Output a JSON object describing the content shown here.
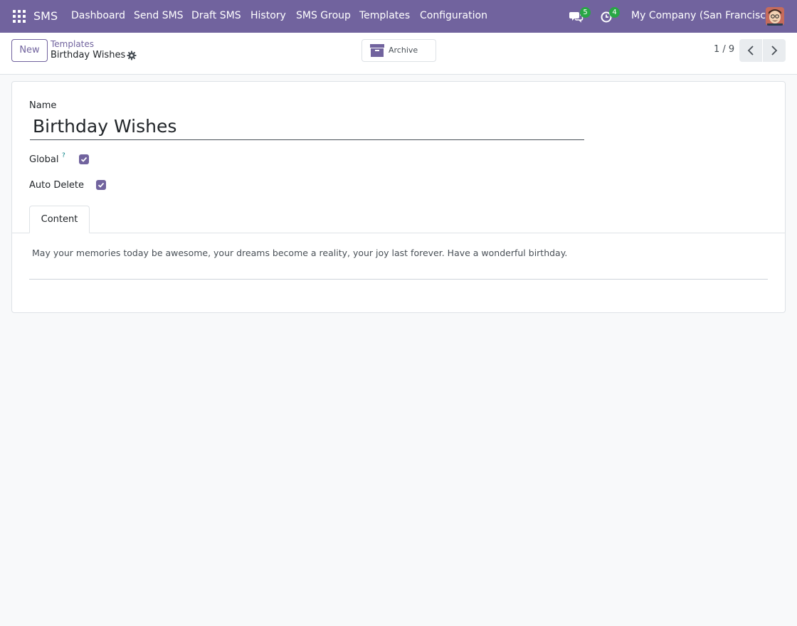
{
  "navbar": {
    "apps_icon": "grid-apps-icon",
    "brand": "SMS",
    "menu": [
      "Dashboard",
      "Send SMS",
      "Draft SMS",
      "History",
      "SMS Group",
      "Templates",
      "Configuration"
    ],
    "messages_icon": "chat-bubbles-icon",
    "messages_count": "5",
    "activities_icon": "clock-activity-icon",
    "activities_count": "4",
    "company": "My Company (San Francisco)",
    "avatar_icon": "user-avatar-icon",
    "color": "#71639e"
  },
  "control_panel": {
    "new_label": "New",
    "breadcrumb_parent": "Templates",
    "breadcrumb_current": "Birthday Wishes",
    "gear_icon": "gear-icon",
    "archive_icon": "archive-box-icon",
    "archive_label": "Archive",
    "pager_value": "1 / 9",
    "prev_icon": "chevron-left-icon",
    "next_icon": "chevron-right-icon"
  },
  "form": {
    "name_label": "Name",
    "name_value": "Birthday Wishes",
    "global_label": "Global",
    "global_help": "?",
    "global_checked": true,
    "auto_delete_label": "Auto Delete",
    "auto_delete_checked": true,
    "tabs": [
      "Content"
    ],
    "content_text": "May your memories today be awesome, your dreams become a reality, your joy last forever. Have a wonderful birthday."
  }
}
